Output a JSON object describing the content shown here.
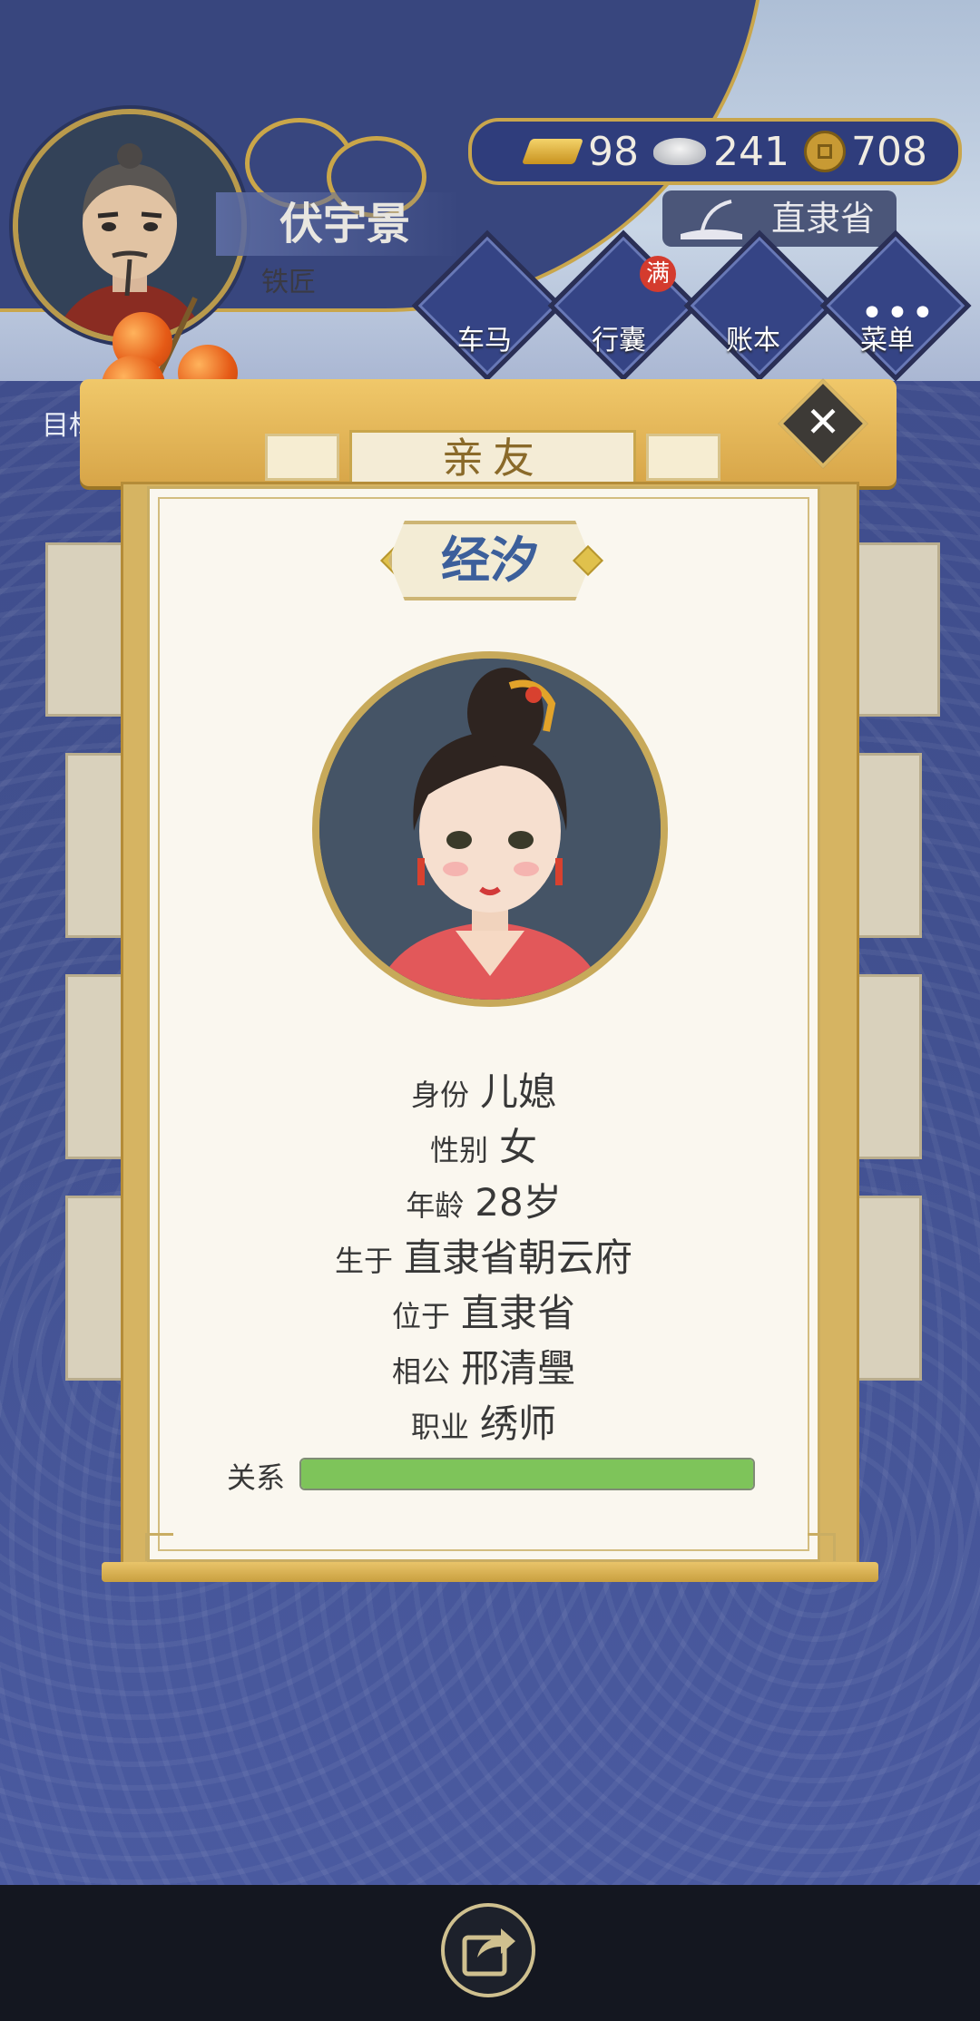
{
  "player": {
    "name": "伏宇景",
    "job": "铁匠"
  },
  "currency": {
    "gold": "98",
    "silver": "241",
    "coins": "708"
  },
  "location": "直隶省",
  "nav": {
    "carriage": "车马",
    "bag": "行囊",
    "bag_badge": "满",
    "ledger": "账本",
    "menu": "菜单"
  },
  "goal": "目标",
  "modal": {
    "title": "亲友",
    "close": "✕",
    "person_name": "经汐",
    "rows": [
      {
        "key": "身份",
        "value": "儿媳"
      },
      {
        "key": "性别",
        "value": "女"
      },
      {
        "key": "年龄",
        "value": "28岁"
      },
      {
        "key": "生于",
        "value": "直隶省朝云府"
      },
      {
        "key": "位于",
        "value": "直隶省"
      },
      {
        "key": "相公",
        "value": "邢清璺"
      },
      {
        "key": "职业",
        "value": "绣师"
      }
    ],
    "relation_label": "关系",
    "relation_level": 1.0
  },
  "colors": {
    "relation_fill": "#7ec45a",
    "gold_trim": "#c9a64c",
    "name_blue": "#3c5f9b"
  }
}
